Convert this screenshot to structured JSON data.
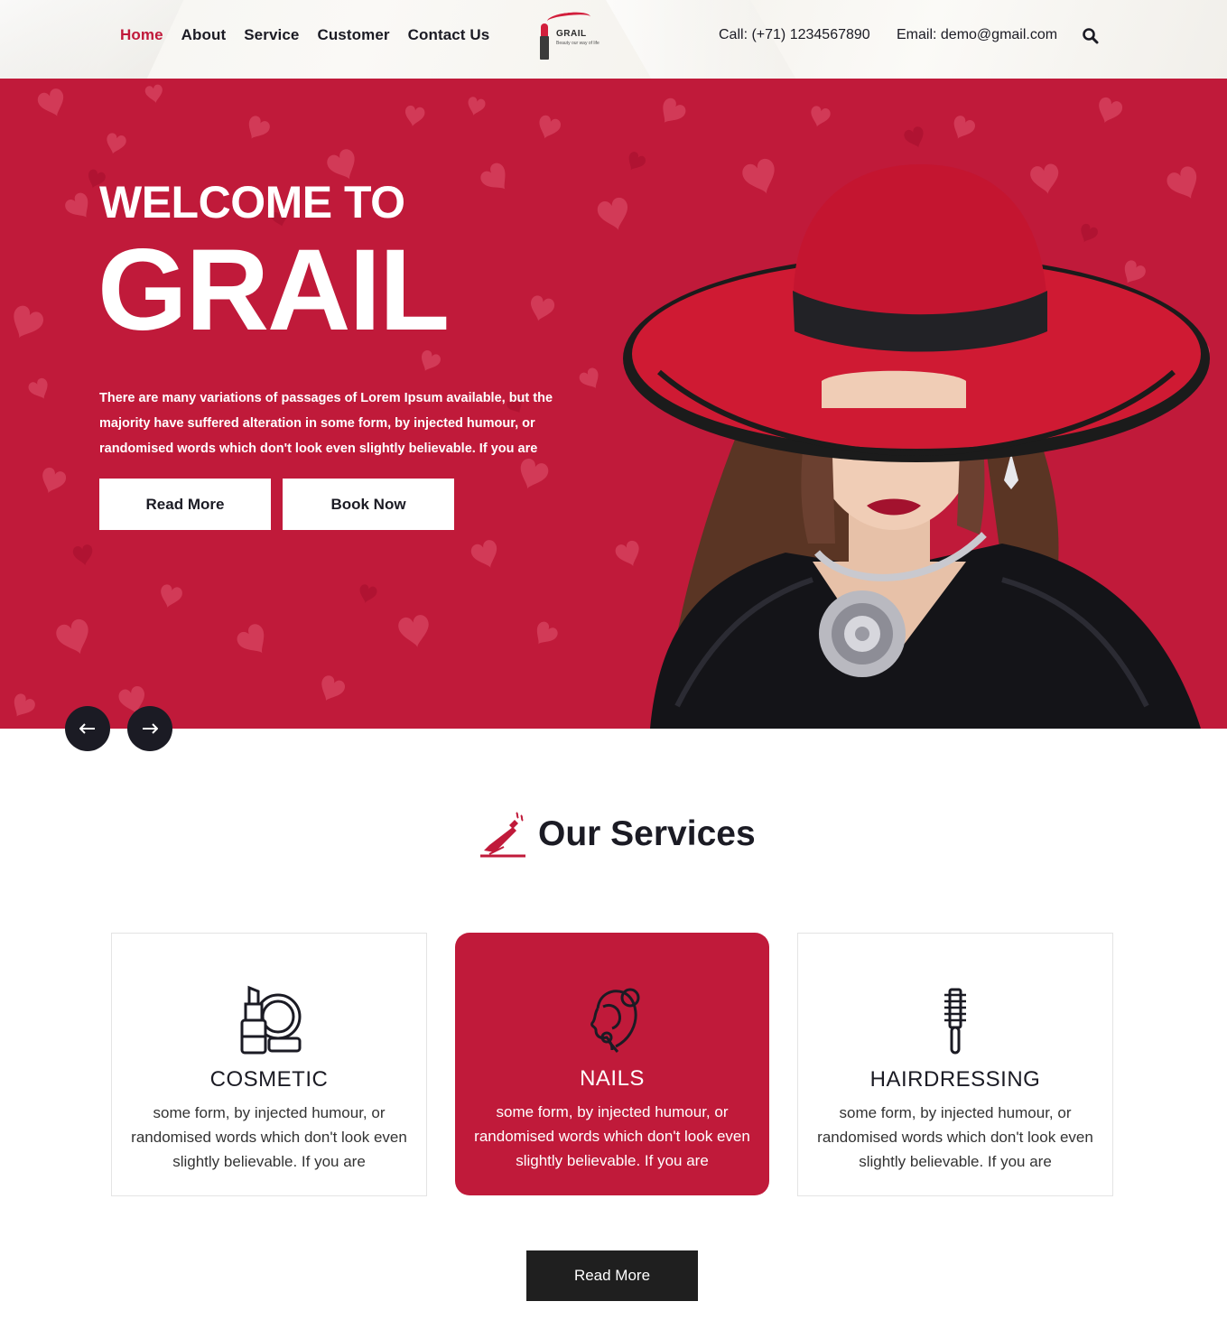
{
  "nav": {
    "items": [
      {
        "label": "Home",
        "active": true
      },
      {
        "label": "About"
      },
      {
        "label": "Service"
      },
      {
        "label": "Customer"
      },
      {
        "label": "Contact Us"
      }
    ]
  },
  "logo": {
    "name": "GRAIL",
    "tagline": "Beauty our way of life"
  },
  "header": {
    "call": "Call: (+71) 1234567890",
    "email": "Email: demo@gmail.com",
    "search_icon": "search-icon"
  },
  "hero": {
    "title_small": "WELCOME TO",
    "title_big": "GRAIL",
    "text": "There are many variations of passages of Lorem Ipsum available, but the majority have suffered alteration in some form, by injected humour, or randomised words which don't look even slightly believable. If you are",
    "read_more": "Read More",
    "book_now": "Book Now",
    "prev_icon": "arrow-left-icon",
    "next_icon": "arrow-right-icon"
  },
  "services": {
    "heading": "Our Services",
    "cards": [
      {
        "title": "COSMETIC",
        "text": "some form, by injected humour, or randomised words which don't look even slightly believable. If you are",
        "icon": "cosmetic-icon"
      },
      {
        "title": "NAILS",
        "text": "some form, by injected humour, or randomised words which don't look even slightly believable. If you are",
        "icon": "face-icon"
      },
      {
        "title": "HAIRDRESSING",
        "text": "some form, by injected humour, or randomised words which don't look even slightly believable. If you are",
        "icon": "hairbrush-icon"
      }
    ],
    "read_more": "Read More"
  },
  "colors": {
    "accent": "#c01a3a",
    "dark": "#1b1b24"
  }
}
